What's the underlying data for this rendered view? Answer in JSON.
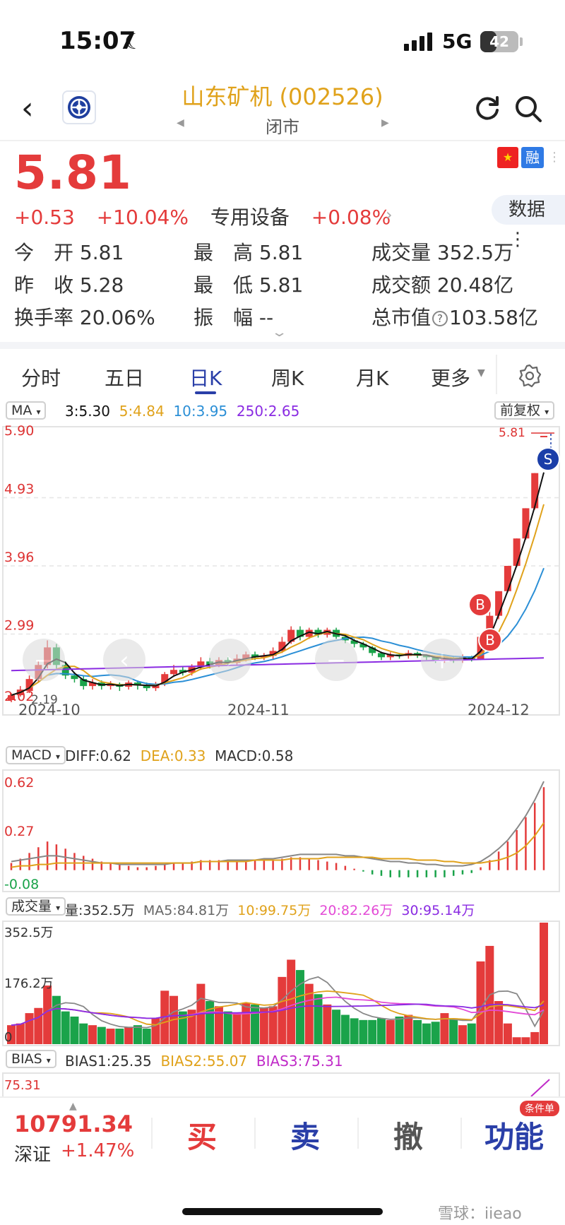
{
  "status_bar": {
    "time": "15:07",
    "network": "5G",
    "battery": 42
  },
  "header": {
    "title": "山东矿机 (002526)",
    "market_state": "闭市"
  },
  "quote": {
    "price": "5.81",
    "change": "+0.53",
    "change_pct": "+10.04%",
    "sector": "专用设备",
    "sector_change": "+0.08%",
    "badge_rong": "融",
    "data_button": "数据",
    "stats": {
      "open_label": "今　开",
      "open": "5.81",
      "high_label": "最　高",
      "high": "5.81",
      "volume_label": "成交量",
      "volume": "352.5万",
      "prev_close_label": "昨　收",
      "prev_close": "5.28",
      "low_label": "最　低",
      "low": "5.81",
      "amount_label": "成交额",
      "amount": "20.48亿",
      "turnover_label": "换手率",
      "turnover": "20.06%",
      "amplitude_label": "振　幅",
      "amplitude": "--",
      "mcap_label": "总市值",
      "mcap": "103.58亿"
    }
  },
  "tabs": [
    "分时",
    "五日",
    "日K",
    "周K",
    "月K",
    "更多"
  ],
  "indicators": {
    "ma": {
      "pill": "MA",
      "ma3": "3:5.30",
      "ma5": "5:4.84",
      "ma10": "10:3.95",
      "ma250": "250:2.65",
      "adjust": "前复权"
    },
    "macd": {
      "pill": "MACD",
      "diff": "DIFF:0.62",
      "dea": "DEA:0.33",
      "macd": "MACD:0.58"
    },
    "vol": {
      "pill": "成交量",
      "vol": "量:352.5万",
      "ma5": "MA5:84.81万",
      "ma10": "10:99.75万",
      "ma20": "20:82.26万",
      "ma30": "30:95.14万"
    },
    "bias": {
      "pill": "BIAS",
      "b1": "BIAS1:25.35",
      "b2": "BIAS2:55.07",
      "b3": "BIAS3:75.31"
    }
  },
  "colors": {
    "up": "#e43b3b",
    "down": "#1aa34a",
    "ma3": "#111111",
    "ma5": "#e0a21b",
    "ma10": "#2b8fd6",
    "ma250": "#8a2be2",
    "accent": "#2a3fa8"
  },
  "chart_data": [
    {
      "type": "candlestick",
      "title": "",
      "x_ticks": [
        "2024-10",
        "2024-11",
        "2024-12"
      ],
      "y_ticks": [
        "5.90",
        "4.93",
        "3.96",
        "2.99",
        "2.02"
      ],
      "ylim": [
        2.02,
        5.9
      ],
      "last_label": "5.81",
      "low_label": "2.19",
      "markers": [
        "B",
        "B",
        "S"
      ],
      "candles": [
        [
          2.05,
          2.12,
          2.02,
          2.15
        ],
        [
          2.12,
          2.2,
          2.1,
          2.25
        ],
        [
          2.18,
          2.35,
          2.15,
          2.4
        ],
        [
          2.35,
          2.55,
          2.3,
          2.6
        ],
        [
          2.55,
          2.8,
          2.5,
          2.9
        ],
        [
          2.8,
          2.55,
          2.5,
          2.85
        ],
        [
          2.55,
          2.4,
          2.35,
          2.6
        ],
        [
          2.4,
          2.35,
          2.3,
          2.45
        ],
        [
          2.35,
          2.25,
          2.2,
          2.4
        ],
        [
          2.25,
          2.3,
          2.2,
          2.35
        ],
        [
          2.3,
          2.25,
          2.2,
          2.33
        ],
        [
          2.25,
          2.28,
          2.2,
          2.32
        ],
        [
          2.28,
          2.24,
          2.18,
          2.3
        ],
        [
          2.24,
          2.3,
          2.2,
          2.33
        ],
        [
          2.3,
          2.26,
          2.2,
          2.33
        ],
        [
          2.26,
          2.22,
          2.18,
          2.3
        ],
        [
          2.22,
          2.28,
          2.18,
          2.31
        ],
        [
          2.28,
          2.42,
          2.25,
          2.45
        ],
        [
          2.42,
          2.48,
          2.38,
          2.55
        ],
        [
          2.48,
          2.44,
          2.4,
          2.52
        ],
        [
          2.44,
          2.52,
          2.4,
          2.56
        ],
        [
          2.52,
          2.6,
          2.48,
          2.66
        ],
        [
          2.6,
          2.55,
          2.5,
          2.65
        ],
        [
          2.55,
          2.62,
          2.52,
          2.66
        ],
        [
          2.62,
          2.58,
          2.54,
          2.66
        ],
        [
          2.58,
          2.64,
          2.55,
          2.7
        ],
        [
          2.64,
          2.7,
          2.6,
          2.74
        ],
        [
          2.7,
          2.66,
          2.62,
          2.74
        ],
        [
          2.66,
          2.68,
          2.62,
          2.72
        ],
        [
          2.68,
          2.75,
          2.62,
          2.8
        ],
        [
          2.75,
          2.88,
          2.72,
          2.95
        ],
        [
          2.88,
          3.05,
          2.85,
          3.1
        ],
        [
          3.05,
          2.95,
          2.9,
          3.1
        ],
        [
          2.95,
          3.05,
          2.92,
          3.08
        ],
        [
          3.05,
          2.98,
          2.94,
          3.08
        ],
        [
          2.98,
          3.05,
          2.94,
          3.08
        ],
        [
          3.05,
          2.95,
          2.92,
          3.08
        ],
        [
          2.95,
          2.9,
          2.86,
          2.98
        ],
        [
          2.9,
          2.85,
          2.8,
          2.92
        ],
        [
          2.85,
          2.8,
          2.76,
          2.88
        ],
        [
          2.8,
          2.72,
          2.68,
          2.82
        ],
        [
          2.72,
          2.66,
          2.62,
          2.74
        ],
        [
          2.66,
          2.7,
          2.62,
          2.73
        ],
        [
          2.7,
          2.68,
          2.64,
          2.72
        ],
        [
          2.68,
          2.72,
          2.64,
          2.76
        ],
        [
          2.72,
          2.69,
          2.65,
          2.74
        ],
        [
          2.69,
          2.66,
          2.62,
          2.7
        ],
        [
          2.66,
          2.62,
          2.58,
          2.68
        ],
        [
          2.62,
          2.65,
          2.58,
          2.68
        ],
        [
          2.65,
          2.62,
          2.58,
          2.68
        ],
        [
          2.62,
          2.66,
          2.58,
          2.7
        ],
        [
          2.66,
          2.63,
          2.6,
          2.68
        ],
        [
          2.63,
          2.95,
          2.62,
          2.98
        ],
        [
          2.95,
          3.25,
          2.9,
          3.35
        ],
        [
          3.25,
          3.6,
          3.2,
          3.6
        ],
        [
          3.6,
          3.96,
          3.58,
          3.96
        ],
        [
          3.96,
          4.35,
          3.94,
          4.35
        ],
        [
          4.35,
          4.78,
          4.33,
          4.78
        ],
        [
          4.78,
          5.28,
          4.76,
          5.28
        ],
        [
          5.81,
          5.81,
          5.81,
          5.81
        ]
      ],
      "ma_last": {
        "ma3": 5.3,
        "ma5": 4.84,
        "ma10": 3.95,
        "ma250": 2.65
      }
    },
    {
      "type": "bar",
      "title": "MACD",
      "y_ticks": [
        "0.62",
        "0.27",
        "-0.08"
      ],
      "ylim": [
        -0.12,
        0.66
      ],
      "macd": [
        0.05,
        0.08,
        0.12,
        0.16,
        0.2,
        0.18,
        0.15,
        0.12,
        0.1,
        0.08,
        0.06,
        0.05,
        0.04,
        0.03,
        0.02,
        0.02,
        0.03,
        0.04,
        0.05,
        0.05,
        0.06,
        0.07,
        0.07,
        0.07,
        0.06,
        0.06,
        0.06,
        0.07,
        0.07,
        0.07,
        0.08,
        0.09,
        0.09,
        0.08,
        0.07,
        0.06,
        0.05,
        0.03,
        0.01,
        -0.01,
        -0.03,
        -0.04,
        -0.05,
        -0.05,
        -0.05,
        -0.05,
        -0.05,
        -0.05,
        -0.05,
        -0.04,
        -0.03,
        -0.02,
        0.02,
        0.07,
        0.13,
        0.2,
        0.28,
        0.37,
        0.47,
        0.58
      ],
      "diff": [
        0.06,
        0.07,
        0.08,
        0.09,
        0.1,
        0.1,
        0.09,
        0.08,
        0.07,
        0.06,
        0.05,
        0.05,
        0.04,
        0.04,
        0.04,
        0.04,
        0.04,
        0.04,
        0.05,
        0.05,
        0.05,
        0.06,
        0.06,
        0.06,
        0.07,
        0.07,
        0.07,
        0.07,
        0.08,
        0.08,
        0.09,
        0.1,
        0.11,
        0.11,
        0.11,
        0.11,
        0.11,
        0.1,
        0.1,
        0.09,
        0.08,
        0.07,
        0.06,
        0.06,
        0.05,
        0.05,
        0.04,
        0.04,
        0.03,
        0.03,
        0.03,
        0.04,
        0.06,
        0.1,
        0.15,
        0.21,
        0.29,
        0.38,
        0.49,
        0.62
      ],
      "dea": [
        0.02,
        0.03,
        0.03,
        0.04,
        0.04,
        0.05,
        0.05,
        0.05,
        0.05,
        0.05,
        0.05,
        0.05,
        0.05,
        0.05,
        0.05,
        0.05,
        0.05,
        0.05,
        0.05,
        0.05,
        0.05,
        0.06,
        0.06,
        0.06,
        0.06,
        0.06,
        0.06,
        0.07,
        0.07,
        0.07,
        0.07,
        0.08,
        0.08,
        0.08,
        0.08,
        0.09,
        0.09,
        0.09,
        0.09,
        0.09,
        0.09,
        0.08,
        0.08,
        0.08,
        0.08,
        0.07,
        0.07,
        0.07,
        0.06,
        0.06,
        0.05,
        0.05,
        0.05,
        0.06,
        0.07,
        0.09,
        0.12,
        0.17,
        0.24,
        0.33
      ]
    },
    {
      "type": "bar",
      "title": "成交量",
      "y_ticks": [
        "352.5万",
        "176.2万",
        "0"
      ],
      "ylim": [
        0,
        352.5
      ],
      "volumes": [
        55,
        60,
        90,
        105,
        170,
        140,
        95,
        80,
        60,
        55,
        50,
        45,
        45,
        50,
        55,
        45,
        75,
        155,
        140,
        95,
        100,
        175,
        125,
        110,
        95,
        90,
        120,
        115,
        105,
        110,
        195,
        245,
        215,
        175,
        145,
        115,
        100,
        85,
        75,
        70,
        70,
        75,
        70,
        80,
        85,
        70,
        60,
        65,
        90,
        75,
        55,
        60,
        240,
        285,
        125,
        60,
        20,
        20,
        35,
        352.5
      ],
      "up": [
        1,
        1,
        1,
        1,
        1,
        0,
        0,
        0,
        0,
        1,
        0,
        1,
        0,
        1,
        0,
        0,
        1,
        1,
        1,
        0,
        1,
        1,
        0,
        1,
        0,
        1,
        1,
        0,
        1,
        1,
        1,
        1,
        0,
        1,
        0,
        1,
        0,
        0,
        0,
        0,
        0,
        0,
        1,
        0,
        1,
        0,
        0,
        0,
        1,
        0,
        1,
        0,
        1,
        1,
        1,
        1,
        1,
        1,
        1,
        1
      ]
    },
    {
      "type": "line",
      "title": "BIAS",
      "y_ticks": [
        "75.31"
      ]
    }
  ],
  "bottom_bar": {
    "index_value": "10791.34",
    "index_name": "深证",
    "index_change": "+1.47%",
    "buy": "买",
    "sell": "卖",
    "cancel": "撤",
    "func": "功能",
    "cond_badge": "条件单"
  },
  "watermark": "雪球：iieao"
}
